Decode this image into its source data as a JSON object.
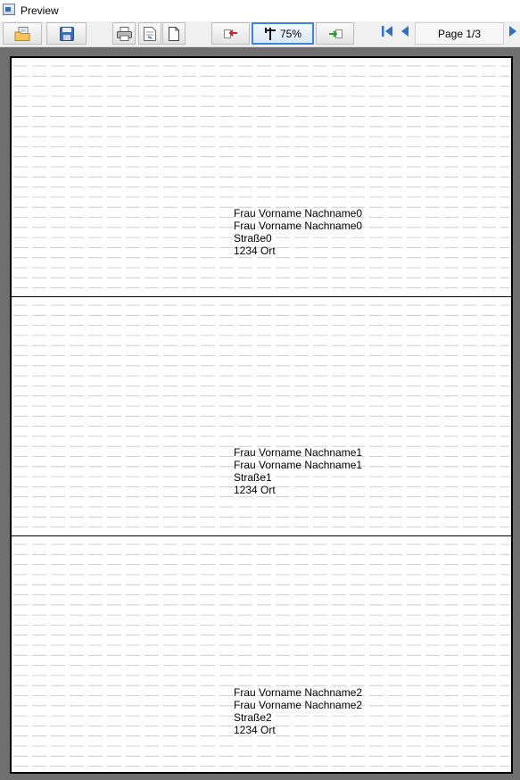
{
  "window": {
    "title": "Preview",
    "icon": "preview-window-icon"
  },
  "toolbar": {
    "buttons": [
      {
        "name": "open-button",
        "icon": "open-folder-icon"
      },
      {
        "name": "save-button",
        "icon": "floppy-disk-icon"
      },
      {
        "name": "print-button",
        "icon": "printer-icon"
      },
      {
        "name": "page-setup-button",
        "icon": "page-setup-icon"
      },
      {
        "name": "single-page-button",
        "icon": "page-icon"
      },
      {
        "name": "zoom-out-button",
        "icon": "zoom-out-icon"
      },
      {
        "name": "zoom-in-button",
        "icon": "zoom-in-icon"
      }
    ],
    "zoom_label": "75%",
    "page_indicator": "Page 1/3"
  },
  "labels": [
    {
      "lines": [
        "Frau Vorname Nachname0",
        "Frau Vorname Nachname0",
        "Straße0",
        "1234 Ort"
      ]
    },
    {
      "lines": [
        "Frau Vorname Nachname1",
        "Frau Vorname Nachname1",
        "Straße1",
        "1234 Ort"
      ]
    },
    {
      "lines": [
        "Frau Vorname Nachname2",
        "Frau Vorname Nachname2",
        "Straße2",
        "1234 Ort"
      ]
    }
  ]
}
